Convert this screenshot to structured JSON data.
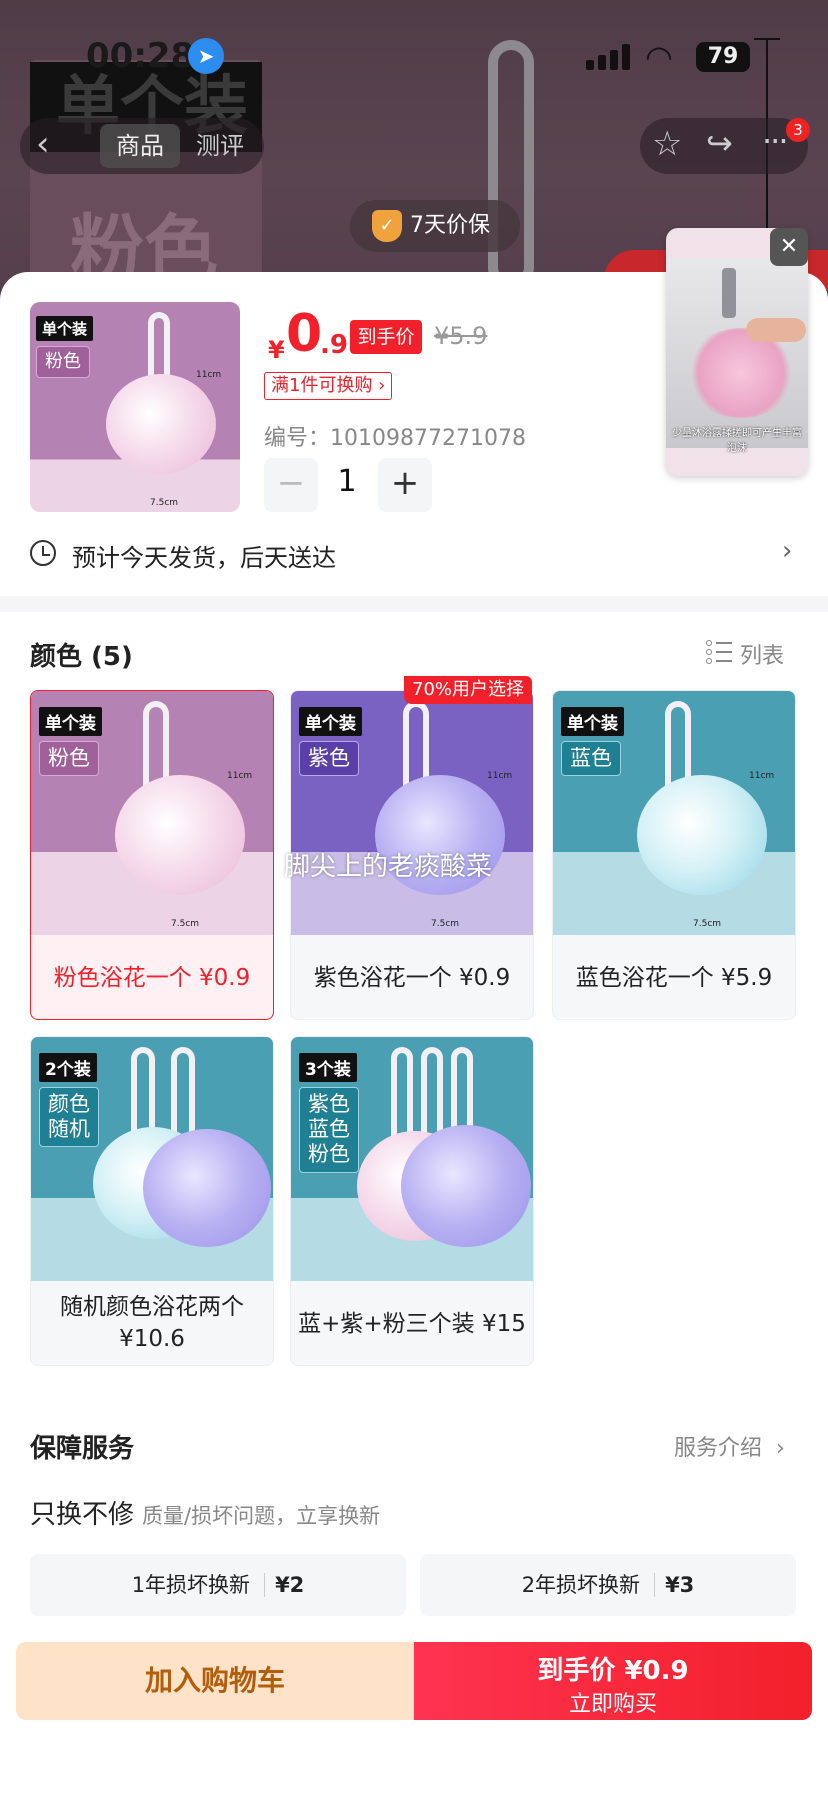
{
  "status_bar": {
    "time": "00:28",
    "battery": "79"
  },
  "header": {
    "tab_product": "商品",
    "tab_review": "测评",
    "more_badge": "3"
  },
  "background_preview": {
    "tag": "单个装",
    "color_word": "粉色"
  },
  "guarantee": "7天价保",
  "product": {
    "price_symbol": "¥",
    "price_int": "0",
    "price_dec": ".9",
    "hand_price_tag": "到手价",
    "original_price": "¥5.9",
    "coupon": "满1件可换购",
    "sku_label": "编号：",
    "sku": "10109877271078",
    "quantity": "1",
    "thumb_tag": "单个装",
    "thumb_color": "粉色",
    "thumb_height": "11cm",
    "thumb_width": "7.5cm"
  },
  "video": {
    "caption": "少量沐浴露揉搓即可产生丰富泡沫"
  },
  "shipping": "预计今天发货，后天送达",
  "color_section": {
    "title": "颜色 (5)",
    "list_label": "列表",
    "popular_badge": "70%用户选择",
    "watermark": "脚尖上的老痰酸菜",
    "options": [
      {
        "label": "粉色浴花一个 ¥0.9",
        "tag": "单个装",
        "color_word": "粉色",
        "height": "11cm",
        "width": "7.5cm"
      },
      {
        "label": "紫色浴花一个 ¥0.9",
        "tag": "单个装",
        "color_word": "紫色",
        "height": "11cm",
        "width": "7.5cm"
      },
      {
        "label": "蓝色浴花一个 ¥5.9",
        "tag": "单个装",
        "color_word": "蓝色",
        "height": "11cm",
        "width": "7.5cm"
      },
      {
        "label_line1": "随机颜色浴花两个",
        "label_line2": "¥10.6",
        "tag": "2个装",
        "color_line1": "颜色",
        "color_line2": "随机"
      },
      {
        "label": "蓝+紫+粉三个装 ¥15",
        "tag": "3个装",
        "color_line1": "紫色",
        "color_line2": "蓝色",
        "color_line3": "粉色"
      }
    ]
  },
  "service": {
    "title": "保障服务",
    "link": "服务介绍",
    "subtitle": "只换不修",
    "subtitle_desc": "质量/损坏问题，立享换新",
    "option1_label": "1年损坏换新",
    "option1_price": "¥2",
    "option2_label": "2年损坏换新",
    "option2_price": "¥3"
  },
  "actions": {
    "add_to_cart": "加入购物车",
    "buy_price_label": "到手价 ¥0.9",
    "buy_now": "立即购买"
  },
  "colors": {
    "accent": "#f2202a",
    "cart_bg": "#ffe3c9",
    "cart_text": "#b35e0d"
  }
}
